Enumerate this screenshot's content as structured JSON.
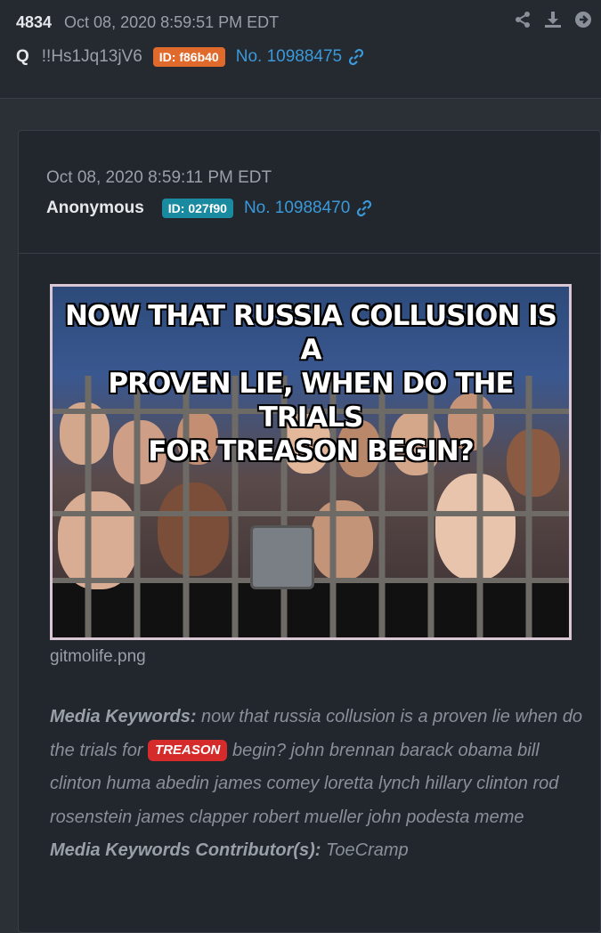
{
  "header": {
    "post_number": "4834",
    "timestamp": "Oct 08, 2020 8:59:51 PM EDT",
    "author": "Q",
    "tripcode": "!!Hs1Jq13jV6",
    "id_badge": "ID: f86b40",
    "post_link": "No. 10988475",
    "actions": [
      "share-icon",
      "download-icon",
      "arrow-right-circle-icon"
    ]
  },
  "quoted": {
    "timestamp": "Oct 08, 2020 8:59:11 PM EDT",
    "author": "Anonymous",
    "id_badge": "ID: 027f90",
    "post_link": "No. 10988470",
    "image": {
      "caption_line1": "NOW THAT RUSSIA COLLUSION IS A",
      "caption_line2": "PROVEN LIE, WHEN DO THE TRIALS",
      "caption_line3": "FOR TREASON BEGIN?"
    },
    "filename": "gitmolife.png",
    "keywords_label": "Media Keywords:",
    "keywords_before": " now that russia collusion is a proven lie when do the trials for ",
    "keywords_highlight": "TREASON",
    "keywords_after": " begin? john brennan barack obama bill clinton huma abedin james comey loretta lynch hillary clinton rod rosenstein james clapper robert mueller john podesta meme",
    "contributor_label": "Media Keywords Contributor(s):",
    "contributor": " ToeCramp"
  },
  "colors": {
    "orange_badge": "#e06a2c",
    "teal_badge": "#1a8aa0",
    "link": "#3a9ad9",
    "highlight": "#d62b2b"
  }
}
